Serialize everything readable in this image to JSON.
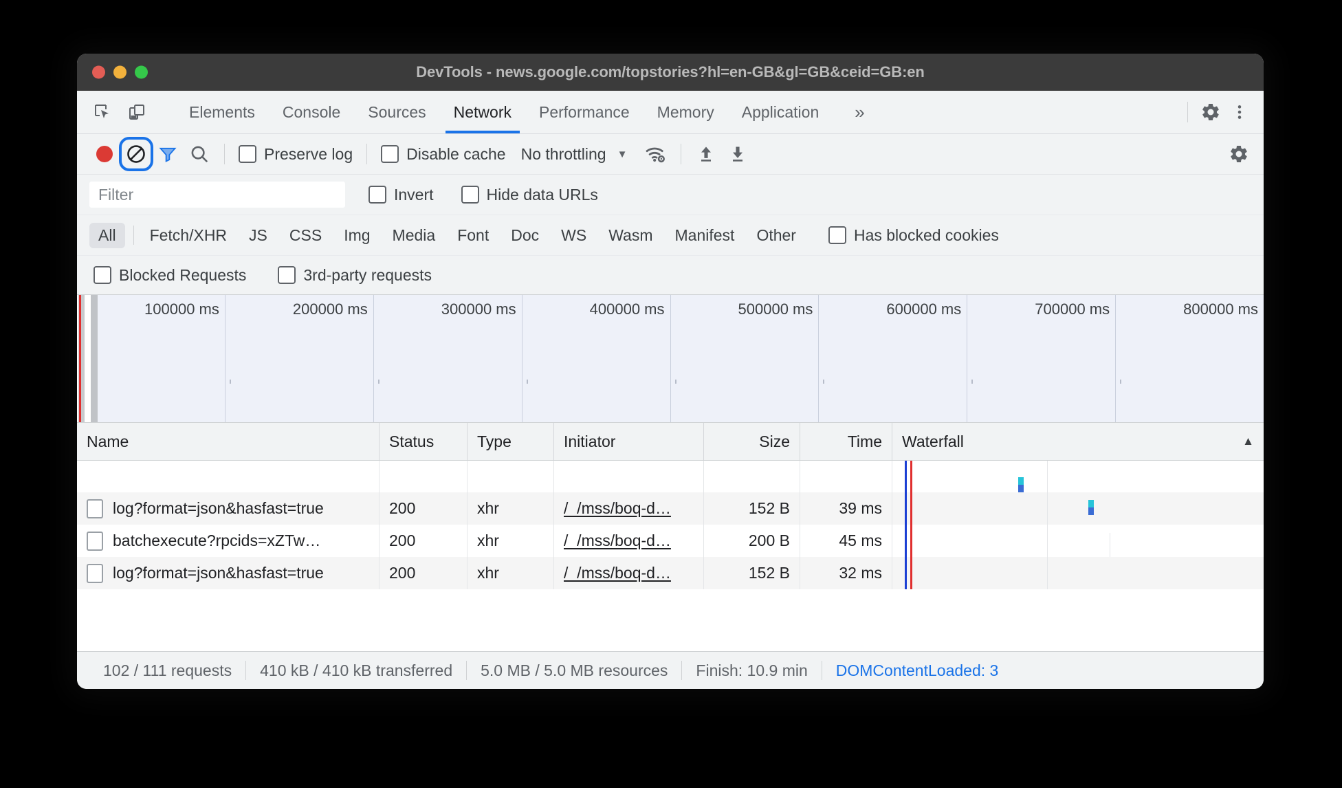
{
  "window": {
    "title": "DevTools - news.google.com/topstories?hl=en-GB&gl=GB&ceid=GB:en"
  },
  "tabbar": {
    "inspect_icon": "inspect-element-icon",
    "device_icon": "device-toolbar-icon",
    "tabs": [
      {
        "label": "Elements",
        "active": false
      },
      {
        "label": "Console",
        "active": false
      },
      {
        "label": "Sources",
        "active": false
      },
      {
        "label": "Network",
        "active": true
      },
      {
        "label": "Performance",
        "active": false
      },
      {
        "label": "Memory",
        "active": false
      },
      {
        "label": "Application",
        "active": false
      }
    ],
    "more_label": "»",
    "settings_icon": "gear-icon",
    "menu_icon": "kebab-menu-icon"
  },
  "toolbar": {
    "record_icon": "record-button",
    "clear_icon": "clear-icon",
    "filter_icon": "filter-funnel-icon",
    "search_icon": "search-icon",
    "preserve_log_label": "Preserve log",
    "preserve_log_checked": false,
    "disable_cache_label": "Disable cache",
    "disable_cache_checked": false,
    "throttling_value": "No throttling",
    "throttling_caret": "▼",
    "network_conditions_icon": "wifi-gear-icon",
    "import_icon": "upload-arrow-icon",
    "export_icon": "download-arrow-icon",
    "settings_icon": "gear-icon",
    "focused_button": "clear-icon"
  },
  "filter_row": {
    "filter_placeholder": "Filter",
    "filter_value": "",
    "invert_label": "Invert",
    "invert_checked": false,
    "hide_data_urls_label": "Hide data URLs",
    "hide_data_urls_checked": false
  },
  "type_filters": {
    "items": [
      {
        "label": "All",
        "selected": true
      },
      {
        "label": "Fetch/XHR",
        "selected": false
      },
      {
        "label": "JS",
        "selected": false
      },
      {
        "label": "CSS",
        "selected": false
      },
      {
        "label": "Img",
        "selected": false
      },
      {
        "label": "Media",
        "selected": false
      },
      {
        "label": "Font",
        "selected": false
      },
      {
        "label": "Doc",
        "selected": false
      },
      {
        "label": "WS",
        "selected": false
      },
      {
        "label": "Wasm",
        "selected": false
      },
      {
        "label": "Manifest",
        "selected": false
      },
      {
        "label": "Other",
        "selected": false
      }
    ],
    "has_blocked_cookies_label": "Has blocked cookies",
    "has_blocked_cookies_checked": false
  },
  "blocked_row": {
    "blocked_requests_label": "Blocked Requests",
    "blocked_requests_checked": false,
    "third_party_label": "3rd-party requests",
    "third_party_checked": false
  },
  "overview": {
    "ticks": [
      "100000 ms",
      "200000 ms",
      "300000 ms",
      "400000 ms",
      "500000 ms",
      "600000 ms",
      "700000 ms",
      "800000 ms"
    ]
  },
  "table": {
    "columns": [
      {
        "label": "Name"
      },
      {
        "label": "Status"
      },
      {
        "label": "Type"
      },
      {
        "label": "Initiator"
      },
      {
        "label": "Size"
      },
      {
        "label": "Time"
      },
      {
        "label": "Waterfall"
      }
    ],
    "sort_indicator": "▲",
    "rows": [
      {
        "name": "log?format=json&hasfast=true",
        "status": "200",
        "type": "xhr",
        "initiator": "/_/mss/boq-d…",
        "size": "152 B",
        "time": "39 ms"
      },
      {
        "name": "batchexecute?rpcids=xZTw…",
        "status": "200",
        "type": "xhr",
        "initiator": "/_/mss/boq-d…",
        "size": "200 B",
        "time": "45 ms"
      },
      {
        "name": "log?format=json&hasfast=true",
        "status": "200",
        "type": "xhr",
        "initiator": "/_/mss/boq-d…",
        "size": "152 B",
        "time": "32 ms"
      }
    ]
  },
  "status_bar": {
    "requests": "102 / 111 requests",
    "transferred": "410 kB / 410 kB transferred",
    "resources": "5.0 MB / 5.0 MB resources",
    "finish": "Finish: 10.9 min",
    "dom_content_loaded": "DOMContentLoaded: 3"
  },
  "colors": {
    "accent": "#1a73e8",
    "record_red": "#db3a34",
    "toolbar_bg": "#f1f3f4",
    "titlebar_bg": "#3b3b3b",
    "overview_bg": "#eef1f9",
    "waterfall_blue": "#1b3fd4",
    "waterfall_red": "#e02f2f"
  }
}
